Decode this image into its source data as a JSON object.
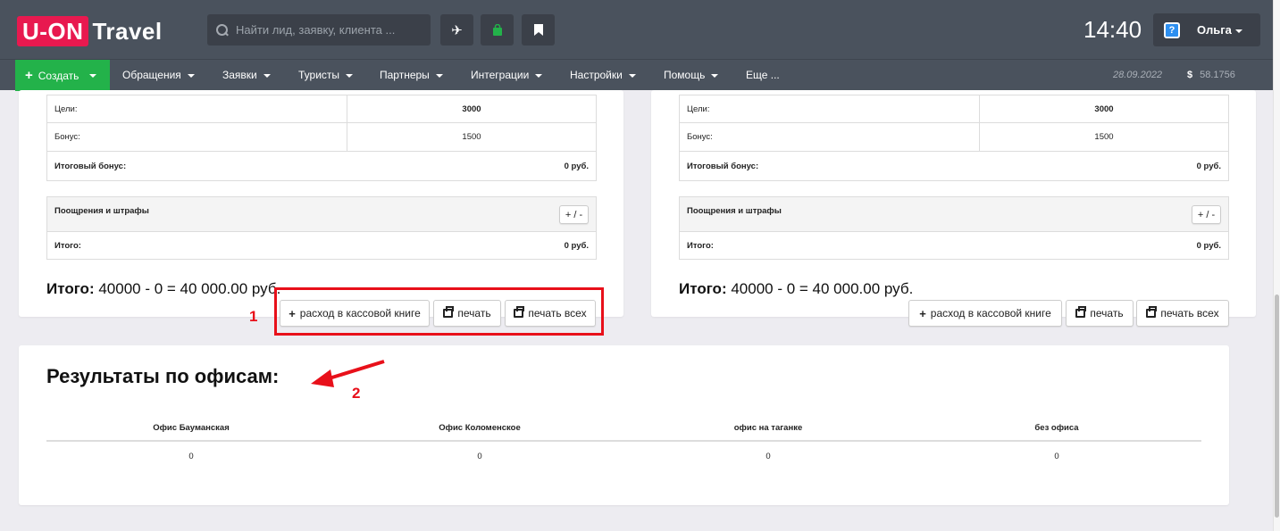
{
  "header": {
    "logo_box": "U-ON",
    "logo_text": "Travel",
    "search_placeholder": "Найти лид, заявку, клиента ...",
    "clock": "14:40",
    "user_name": "Ольга"
  },
  "menu": {
    "create_label": "Создать",
    "items": [
      "Обращения",
      "Заявки",
      "Туристы",
      "Партнеры",
      "Интеграции",
      "Настройки",
      "Помощь",
      "Еще ..."
    ],
    "date": "28.09.2022",
    "currency_symbol": "$",
    "rate": "58.1756"
  },
  "cards": [
    {
      "goals_label": "Цели:",
      "goals_value": "3000",
      "bonus_label": "Бонус:",
      "bonus_value": "1500",
      "total_bonus_label": "Итоговый бонус:",
      "total_bonus_value": "0 руб.",
      "rewards_label": "Поощрения и штрафы",
      "rewards_button": "+ / -",
      "subtotal_label": "Итого:",
      "subtotal_value": "0 руб.",
      "total_prefix": "Итого:",
      "total_expr": "40000 - 0 = 40 000.00 руб.",
      "btn_cashbook": "расход в кассовой книге",
      "btn_print": "печать",
      "btn_print_all": "печать всех"
    },
    {
      "goals_label": "Цели:",
      "goals_value": "3000",
      "bonus_label": "Бонус:",
      "bonus_value": "1500",
      "total_bonus_label": "Итоговый бонус:",
      "total_bonus_value": "0 руб.",
      "rewards_label": "Поощрения и штрафы",
      "rewards_button": "+ / -",
      "subtotal_label": "Итого:",
      "subtotal_value": "0 руб.",
      "total_prefix": "Итого:",
      "total_expr": "40000 - 0 = 40 000.00 руб.",
      "btn_cashbook": "расход в кассовой книге",
      "btn_print": "печать",
      "btn_print_all": "печать всех"
    }
  ],
  "annotations": {
    "num1": "1",
    "num2": "2",
    "color": "#e8101a"
  },
  "results": {
    "title": "Результаты по офисам:",
    "offices": [
      {
        "name": "Офис Бауманская",
        "value": "0"
      },
      {
        "name": "Офис Коломенское",
        "value": "0"
      },
      {
        "name": "офис на таганке",
        "value": "0"
      },
      {
        "name": "без офиса",
        "value": "0"
      }
    ]
  },
  "colors": {
    "brand": "#e8194f",
    "create_green": "#23b24a",
    "topbar": "#4a525d"
  }
}
